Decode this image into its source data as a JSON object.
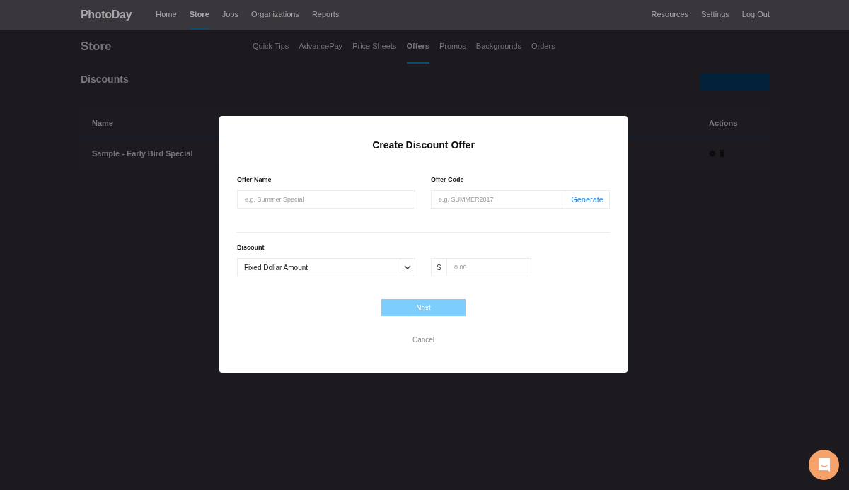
{
  "nav": {
    "logo": "PhotoDay",
    "items": [
      {
        "label": "Home",
        "selected": false
      },
      {
        "label": "Store",
        "selected": true
      },
      {
        "label": "Jobs",
        "selected": false
      },
      {
        "label": "Organizations",
        "selected": false
      },
      {
        "label": "Reports",
        "selected": false
      }
    ],
    "right_items": [
      "Resources",
      "Settings",
      "Log Out"
    ]
  },
  "page": {
    "title": "Store",
    "tabs": [
      {
        "label": "Quick Tips",
        "selected": false
      },
      {
        "label": "AdvancePay",
        "selected": false
      },
      {
        "label": "Price Sheets",
        "selected": false
      },
      {
        "label": "Offers",
        "selected": true
      },
      {
        "label": "Promos",
        "selected": false
      },
      {
        "label": "Backgrounds",
        "selected": false
      },
      {
        "label": "Orders",
        "selected": false
      }
    ],
    "section_title": "Discounts"
  },
  "table": {
    "columns": [
      "Name",
      "Actions"
    ],
    "rows": [
      {
        "name": "Sample - Early Bird Special"
      }
    ]
  },
  "modal": {
    "title": "Create Discount Offer",
    "offer_name": {
      "label": "Offer Name",
      "placeholder": "e.g. Summer Special"
    },
    "offer_code": {
      "label": "Offer Code",
      "placeholder": "e.g. SUMMER2017",
      "button": "Generate"
    },
    "discount": {
      "label": "Discount",
      "type_value": "Fixed Dollar Amount",
      "currency": "$",
      "amount_placeholder": "0.00"
    },
    "next": {
      "label": "Next",
      "disabled": true
    },
    "cancel": "Cancel"
  }
}
